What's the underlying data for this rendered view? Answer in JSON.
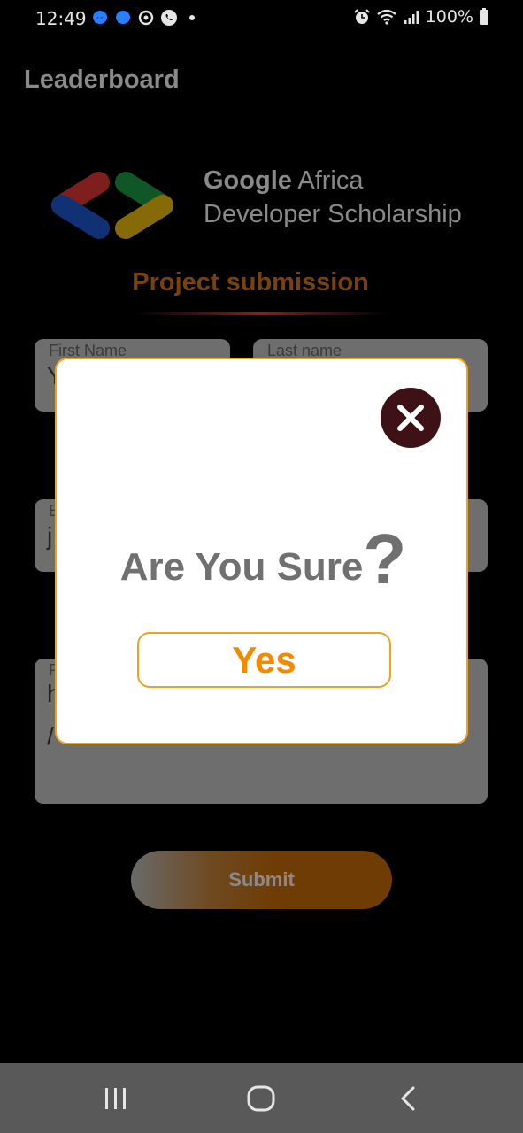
{
  "status_bar": {
    "time": "12:49",
    "battery": "100%",
    "left_icons": [
      "messenger-icon",
      "messenger-icon",
      "sync-icon",
      "whatsapp-icon",
      "dot-icon"
    ],
    "right_icons": [
      "alarm-icon",
      "wifi-icon",
      "signal-icon",
      "battery-icon"
    ]
  },
  "page": {
    "title": "Leaderboard",
    "logo_brand": "Google",
    "logo_line1_rest": " Africa",
    "logo_line2": "Developer Scholarship",
    "section_title": "Project submission"
  },
  "form": {
    "first_name": {
      "label": "First Name",
      "value": "Y"
    },
    "last_name": {
      "label": "Last name",
      "value": ""
    },
    "email": {
      "label": "E",
      "value": "j"
    },
    "project_link": {
      "label": "P",
      "value": "h",
      "value2": "/"
    },
    "submit_label": "Submit"
  },
  "dialog": {
    "message": "Are You Sure",
    "question_mark": "?",
    "yes_label": "Yes",
    "colors": {
      "accent": "#f0a21a",
      "yes_text": "#f28a00",
      "close_bg": "#3d1116"
    }
  },
  "nav_bar": {
    "icons": [
      "recent-apps-icon",
      "home-icon",
      "back-icon"
    ]
  }
}
